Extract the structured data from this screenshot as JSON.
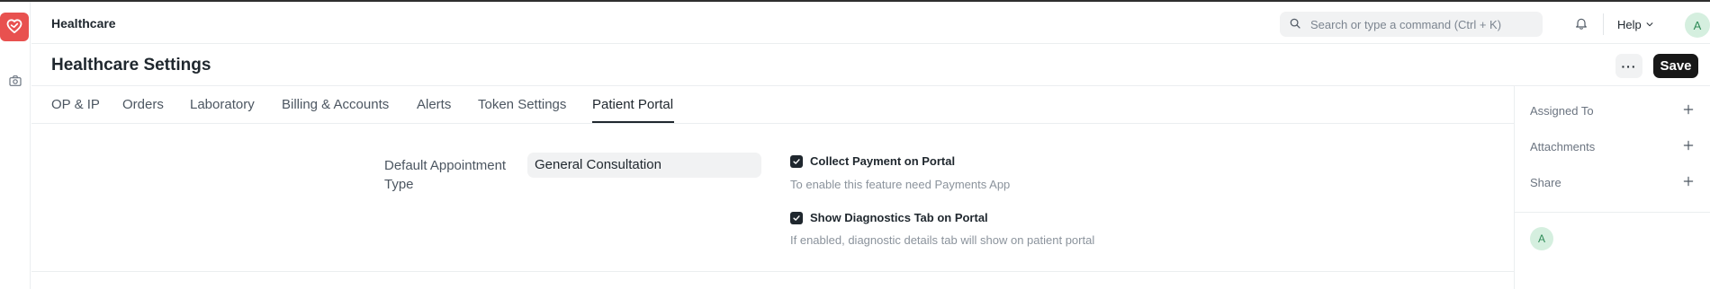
{
  "app": {
    "title": "Healthcare",
    "logo_icon": "heart-icon",
    "brand_color": "#e8514f"
  },
  "navbar": {
    "search_placeholder": "Search or type a command (Ctrl + K)",
    "help_label": "Help",
    "avatar_initial": "A"
  },
  "page": {
    "title": "Healthcare Settings",
    "more_label": "···",
    "save_label": "Save"
  },
  "tabs": [
    {
      "label": "OP & IP",
      "active": false
    },
    {
      "label": "Orders",
      "active": false
    },
    {
      "label": "Laboratory",
      "active": false
    },
    {
      "label": "Billing & Accounts",
      "active": false
    },
    {
      "label": "Alerts",
      "active": false
    },
    {
      "label": "Token Settings",
      "active": false
    },
    {
      "label": "Patient Portal",
      "active": true
    }
  ],
  "form": {
    "default_appointment_type": {
      "label": "Default Appointment Type",
      "value": "General Consultation"
    },
    "collect_payment": {
      "label": "Collect Payment on Portal",
      "checked": true,
      "help": "To enable this feature need Payments App"
    },
    "show_diagnostics": {
      "label": "Show Diagnostics Tab on Portal",
      "checked": true,
      "help": "If enabled, diagnostic details tab will show on patient portal"
    }
  },
  "sidebar": {
    "assigned_to": "Assigned To",
    "attachments": "Attachments",
    "share": "Share",
    "avatar_initial": "A"
  }
}
